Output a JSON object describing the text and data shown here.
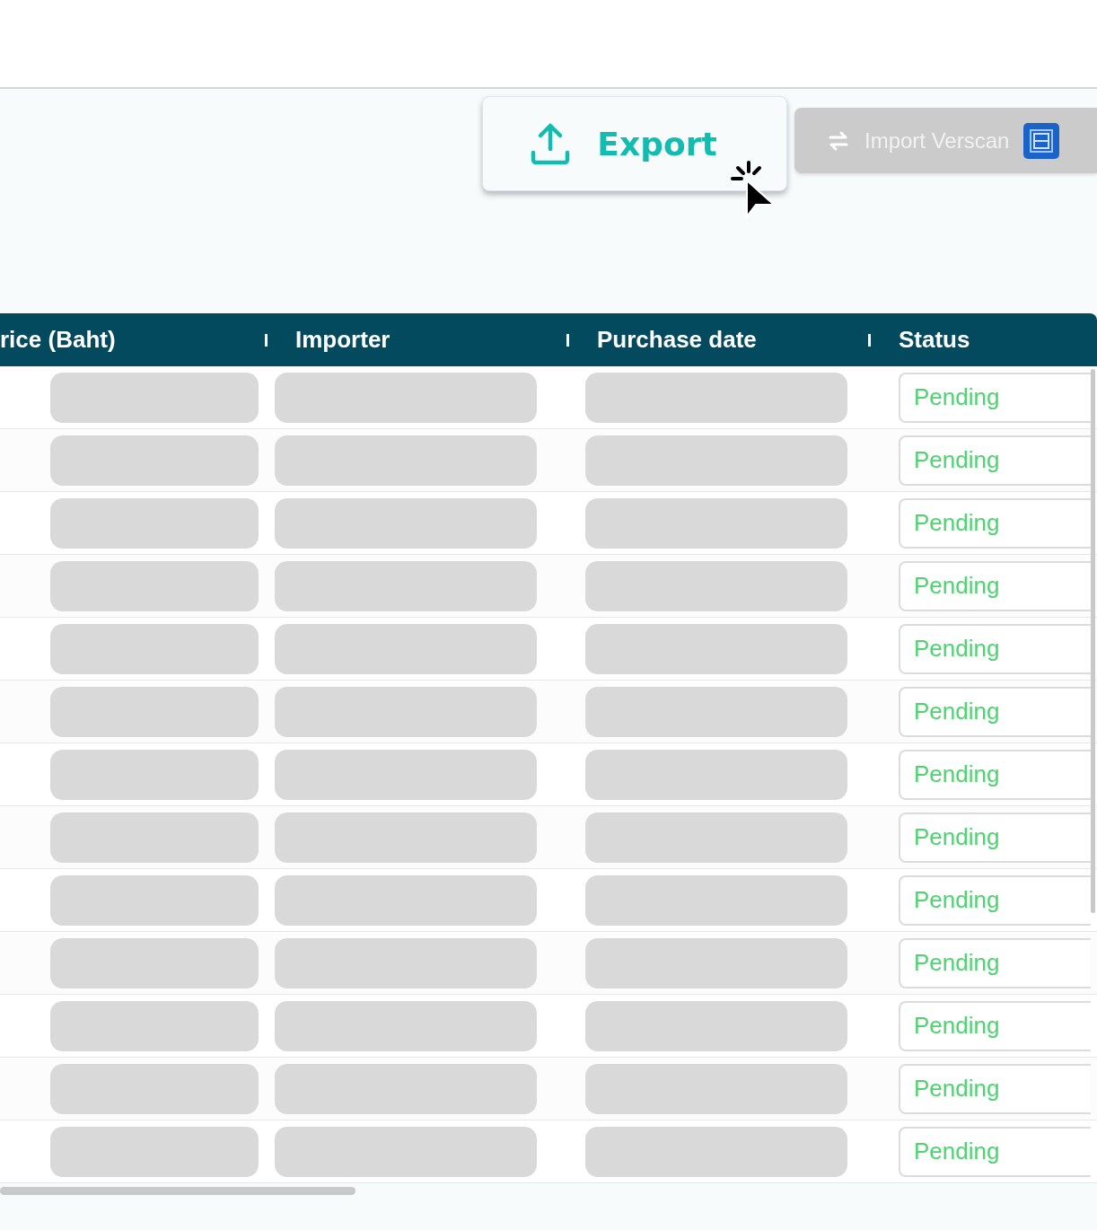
{
  "toolbar": {
    "export_button": "Export",
    "import_button": "Import Verscan"
  },
  "table": {
    "columns": [
      "rice (Baht)",
      "Importer",
      "Purchase date",
      "Status"
    ],
    "rows": [
      {
        "status": "Pending"
      },
      {
        "status": "Pending"
      },
      {
        "status": "Pending"
      },
      {
        "status": "Pending"
      },
      {
        "status": "Pending"
      },
      {
        "status": "Pending"
      },
      {
        "status": "Pending"
      },
      {
        "status": "Pending"
      },
      {
        "status": "Pending"
      },
      {
        "status": "Pending"
      },
      {
        "status": "Pending"
      },
      {
        "status": "Pending"
      },
      {
        "status": "Pending"
      }
    ]
  }
}
